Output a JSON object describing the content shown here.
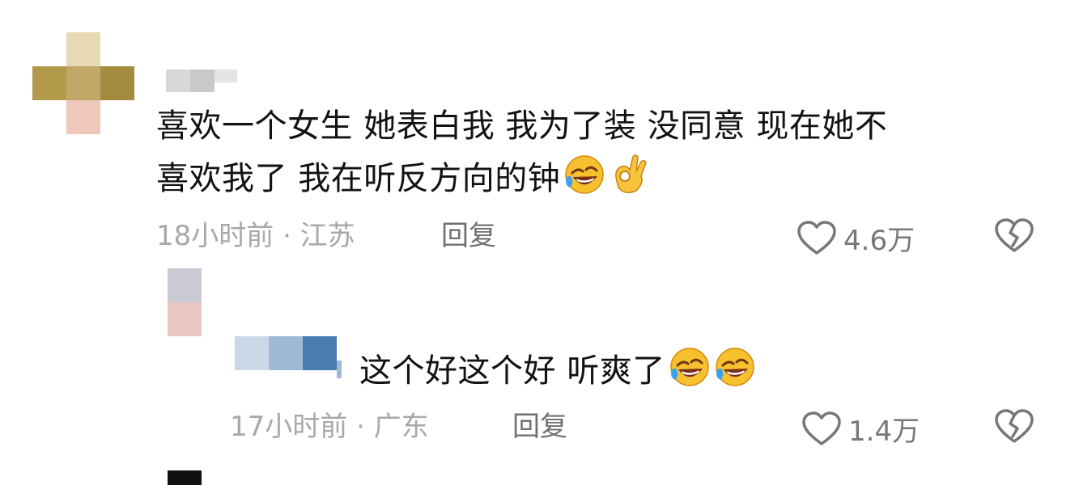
{
  "comments": [
    {
      "text_line1": "喜欢一个女生 她表白我 我为了装 没同意 现在她不",
      "text_line2": "喜欢我了 我在听反方向的钟",
      "time_location": "18小时前 · 江苏",
      "reply_label": "回复",
      "like_count": "4.6万"
    },
    {
      "text": "这个好这个好 听爽了",
      "time_location": "17小时前 · 广东",
      "reply_label": "回复",
      "like_count": "1.4万"
    }
  ],
  "icons": {
    "like": "heart-outline-icon",
    "dislike": "broken-heart-icon",
    "emoji_laugh": "rolling-on-floor-laughing-emoji",
    "emoji_ok": "ok-hand-emoji"
  },
  "colors": {
    "text": "#121212",
    "meta": "#a8a8a8",
    "reply": "#6f6f6f",
    "icon": "#777777"
  }
}
